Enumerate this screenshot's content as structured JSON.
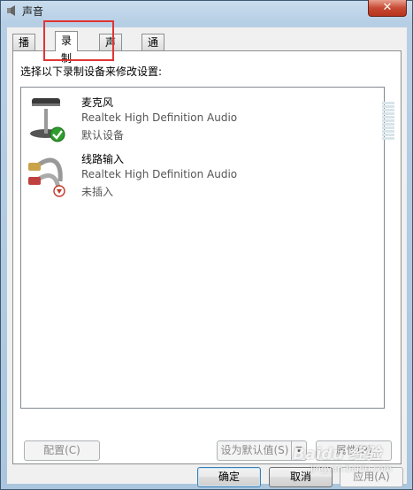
{
  "window": {
    "title": "声音",
    "close_label": "✕"
  },
  "tabs": [
    {
      "label": "播放",
      "active": false
    },
    {
      "label": "录制",
      "active": true
    },
    {
      "label": "声音",
      "active": false
    },
    {
      "label": "通信",
      "active": false
    }
  ],
  "instruction": "选择以下录制设备来修改设置:",
  "devices": [
    {
      "name": "麦克风",
      "description": "Realtek High Definition Audio",
      "status": "默认设备",
      "icon": "microphone-icon",
      "badge": "default-check-icon"
    },
    {
      "name": "线路输入",
      "description": "Realtek High Definition Audio",
      "status": "未插入",
      "icon": "line-in-cable-icon",
      "badge": "unplugged-icon"
    }
  ],
  "buttons": {
    "configure": "配置(C)",
    "set_default": "设为默认值(S)",
    "properties": "属性(P)",
    "ok": "确定",
    "cancel": "取消",
    "apply": "应用(A)"
  },
  "watermark": {
    "text": "Baidu 经验",
    "sub": "jingyan.baidu.com"
  },
  "colors": {
    "highlight": "#e03535",
    "check": "#2e9e2e",
    "unplugged": "#c0392b"
  }
}
